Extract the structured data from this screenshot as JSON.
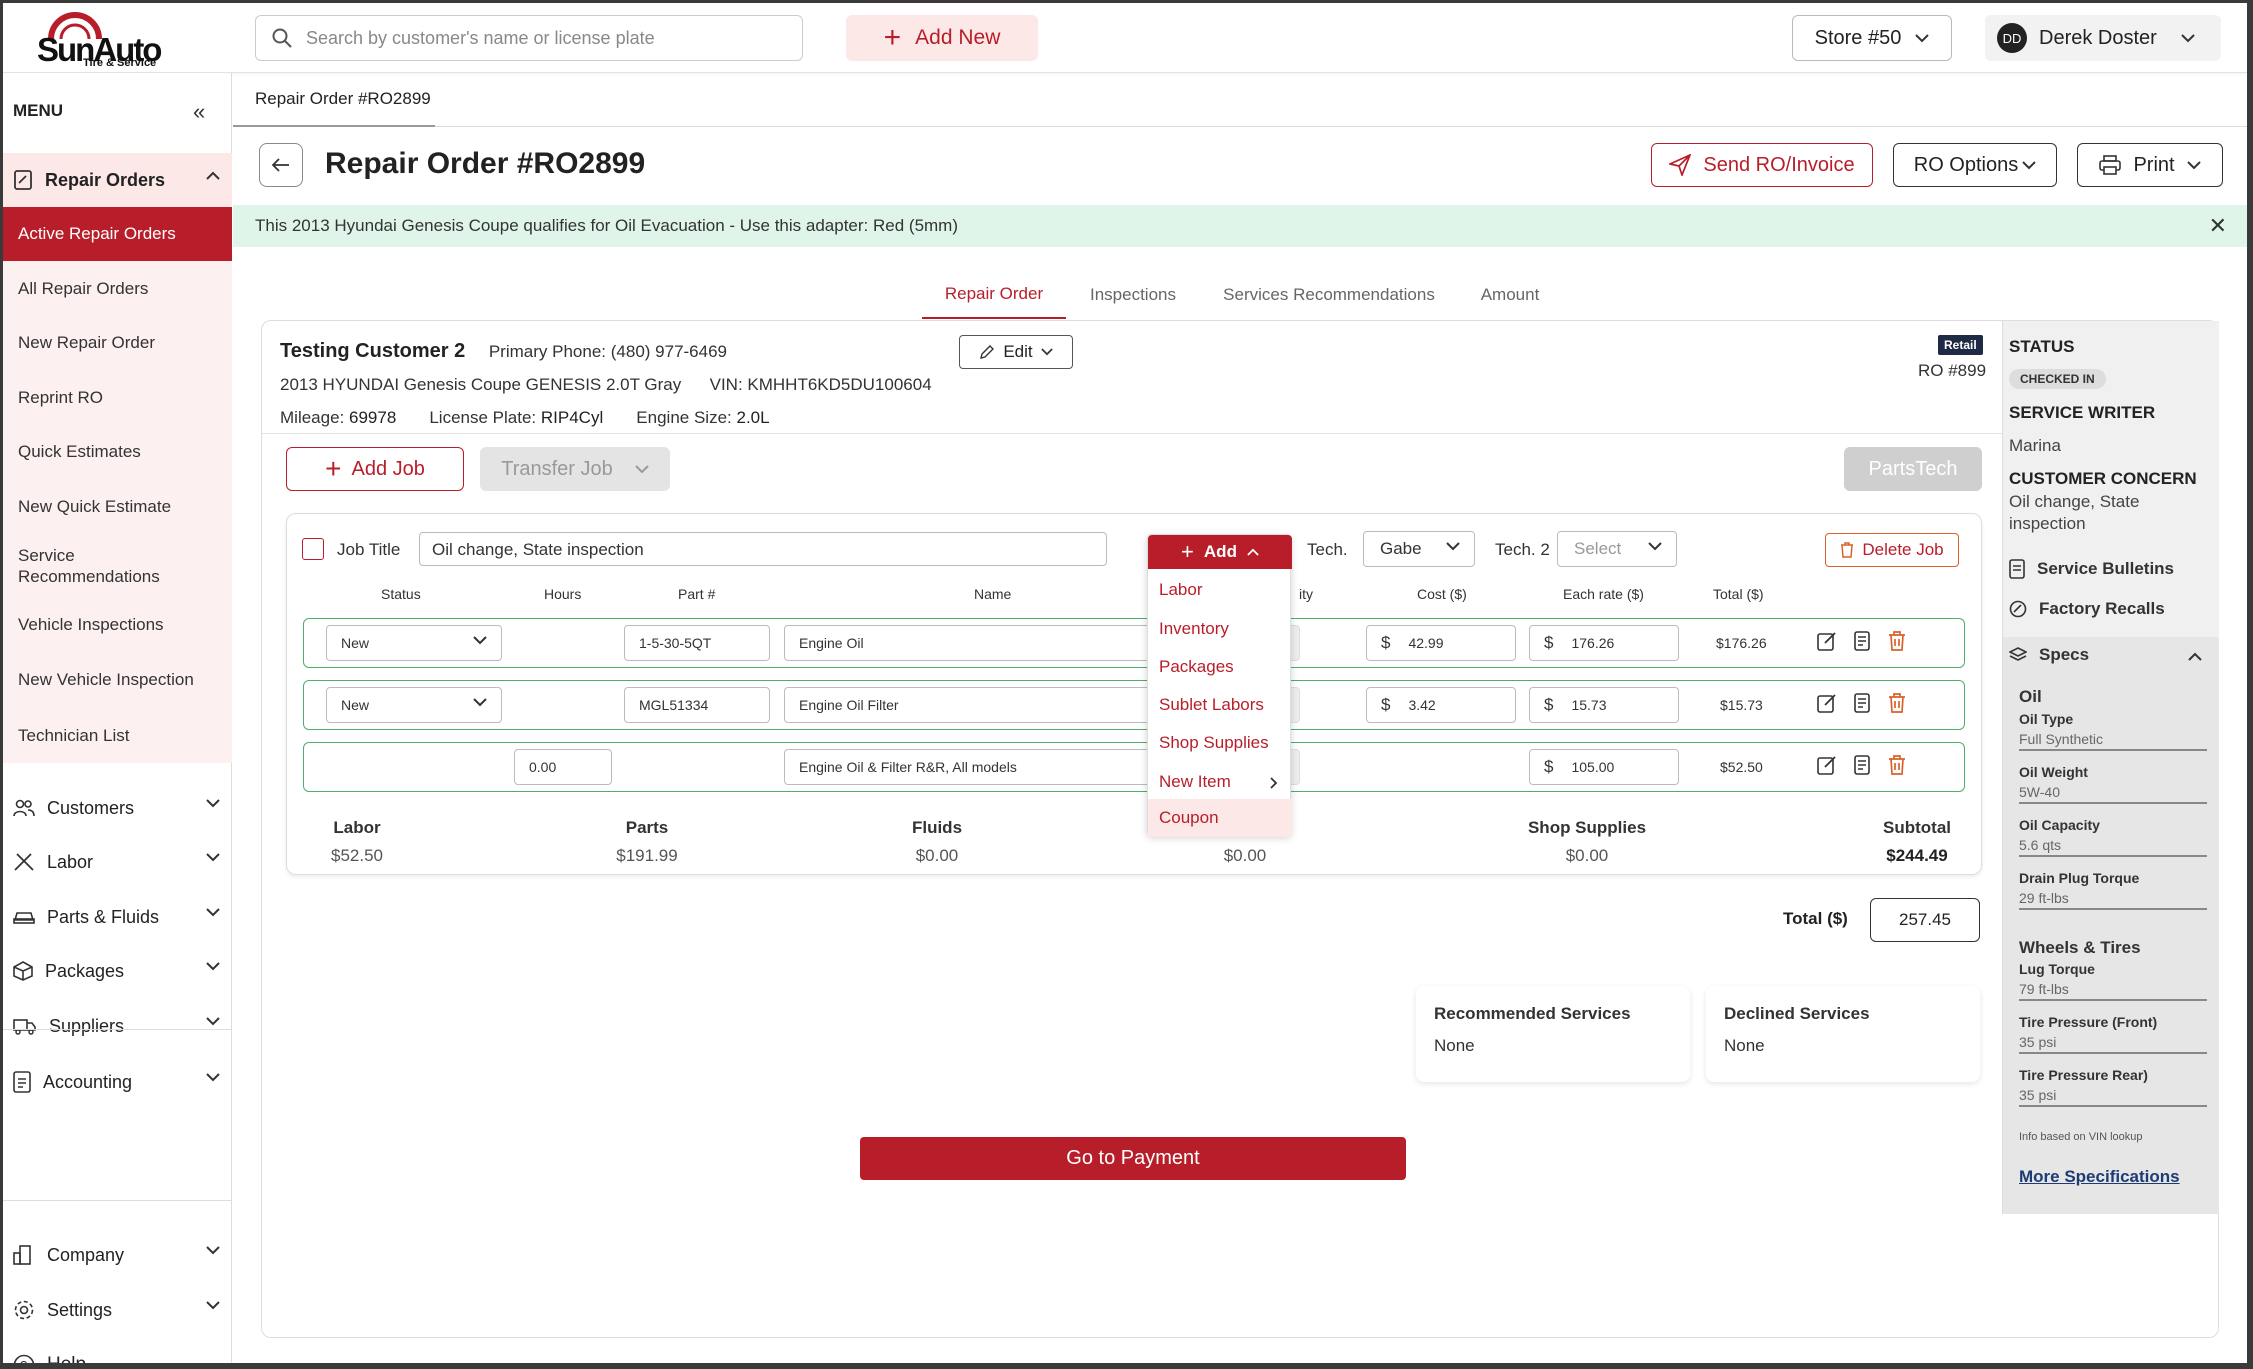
{
  "brand": {
    "logo_text": "SunAuto",
    "logo_sub": "Tire & Service"
  },
  "header": {
    "search_placeholder": "Search by customer's name or license plate",
    "add_new": "Add New",
    "store": "Store #50",
    "user_initials": "DD",
    "user_name": "Derek Doster"
  },
  "sidebar": {
    "menu_label": "MENU",
    "repair_orders": "Repair Orders",
    "repair_sub": [
      "Active Repair Orders",
      "All Repair Orders",
      "New Repair Order",
      "Reprint RO",
      "Quick Estimates",
      "New Quick Estimate",
      "Service Recommendations",
      "Vehicle Inspections",
      "New Vehicle Inspection",
      "Technician List"
    ],
    "sections": [
      "Customers",
      "Labor",
      "Parts & Fluids",
      "Packages",
      "Suppliers",
      "Accounting"
    ],
    "bottom": [
      "Company",
      "Settings"
    ],
    "help": "Help"
  },
  "breadcrumb": "Repair Order #RO2899",
  "page": {
    "title": "Repair Order #RO2899",
    "send": "Send RO/Invoice",
    "ro_options": "RO Options",
    "print": "Print"
  },
  "banner": "This 2013 Hyundai Genesis Coupe qualifies for Oil Evacuation - Use this adapter: Red (5mm)",
  "tabs": [
    "Repair Order",
    "Inspections",
    "Services Recommendations",
    "Amount"
  ],
  "customer": {
    "name": "Testing Customer 2",
    "phone_label": "Primary Phone:",
    "phone": "(480) 977-6469",
    "vehicle": "2013 HYUNDAI Genesis Coupe GENESIS 2.0T Gray",
    "vin_label": "VIN:",
    "vin": "KMHHT6KD5DU100604",
    "mileage_label": "Mileage:",
    "mileage": "69978",
    "plate_label": "License Plate:",
    "plate": "RIP4Cyl",
    "engine_label": "Engine Size:",
    "engine": "2.0L",
    "edit": "Edit",
    "badge": "Retail",
    "ro_number": "RO #899"
  },
  "actions": {
    "add_job": "Add Job",
    "transfer_job": "Transfer Job",
    "partstech": "PartsTech"
  },
  "job": {
    "title_label": "Job Title",
    "title_value": "Oil change,  State inspection",
    "add": "Add",
    "tech_label": "Tech.",
    "tech": "Gabe",
    "tech2_label": "Tech. 2",
    "tech2": "Select",
    "delete": "Delete Job",
    "columns": {
      "status": "Status",
      "hours": "Hours",
      "part": "Part #",
      "name": "Name",
      "qty": "ity",
      "cost": "Cost ($)",
      "rate": "Each rate ($)",
      "total": "Total ($)"
    },
    "rows": [
      {
        "status": "New",
        "hours": "",
        "part": "1-5-30-5QT",
        "name": "Engine Oil",
        "cost": "42.99",
        "rate": "176.26",
        "total": "$176.26"
      },
      {
        "status": "New",
        "hours": "",
        "part": "MGL51334",
        "name": "Engine Oil Filter",
        "cost": "3.42",
        "rate": "15.73",
        "total": "$15.73"
      },
      {
        "status": "",
        "hours": "0.00",
        "part": "",
        "name": "Engine Oil & Filter R&R, All models",
        "cost": "",
        "rate": "105.00",
        "total": "$52.50"
      }
    ],
    "currency": "$",
    "summary": [
      {
        "label": "Labor",
        "value": "$52.50"
      },
      {
        "label": "Parts",
        "value": "$191.99"
      },
      {
        "label": "Fluids",
        "value": "$0.00"
      },
      {
        "label": "",
        "value": "$0.00"
      },
      {
        "label": "Shop Supplies",
        "value": "$0.00"
      },
      {
        "label": "Subtotal",
        "value": "$244.49"
      }
    ]
  },
  "add_menu": [
    "Labor",
    "Inventory",
    "Packages",
    "Sublet Labors",
    "Shop Supplies",
    "New Item",
    "Coupon"
  ],
  "totals": {
    "label": "Total ($)",
    "value": "257.45"
  },
  "services": {
    "recommended": "Recommended Services",
    "recommended_val": "None",
    "declined": "Declined Services",
    "declined_val": "None"
  },
  "payment": "Go to Payment",
  "status_panel": {
    "status_h": "STATUS",
    "status": "CHECKED IN",
    "writer_h": "SERVICE WRITER",
    "writer": "Marina",
    "concern_h": "CUSTOMER CONCERN",
    "concern": "Oil change, State inspection",
    "bulletins": "Service Bulletins",
    "recalls": "Factory Recalls",
    "specs": "Specs",
    "oil_h": "Oil",
    "oil": [
      {
        "k": "Oil Type",
        "v": "Full Synthetic"
      },
      {
        "k": "Oil Weight",
        "v": "5W-40"
      },
      {
        "k": "Oil Capacity",
        "v": "5.6 qts"
      },
      {
        "k": "Drain Plug Torque",
        "v": "29 ft-lbs"
      }
    ],
    "wheels_h": "Wheels & Tires",
    "wheels": [
      {
        "k": "Lug Torque",
        "v": "79 ft-lbs"
      },
      {
        "k": "Tire Pressure (Front)",
        "v": "35 psi"
      },
      {
        "k": "Tire Pressure Rear)",
        "v": "35 psi"
      }
    ],
    "note": "Info based on VIN lookup",
    "more": "More Specifications"
  },
  "colors": {
    "brand_red": "#b81e2a",
    "banner_green": "#dff5ea",
    "row_border": "#4caf6a"
  }
}
